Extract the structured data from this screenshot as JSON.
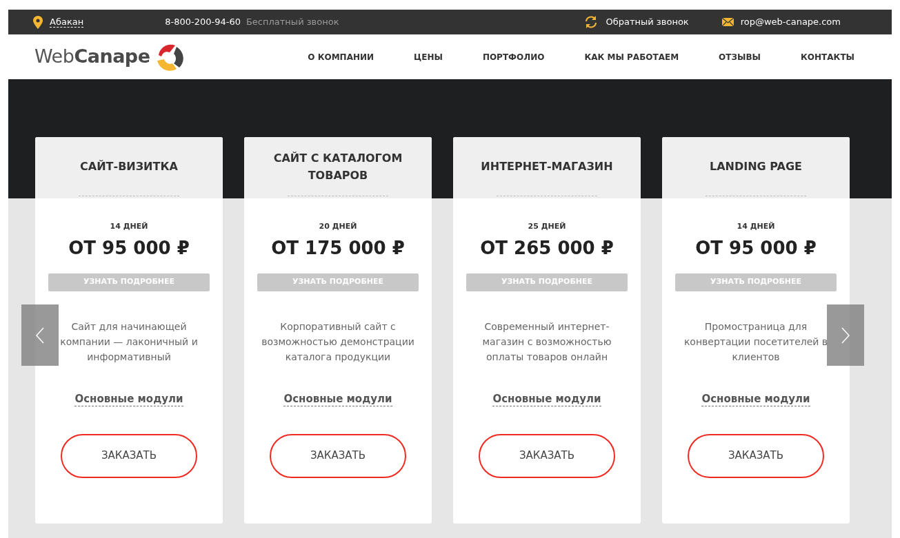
{
  "top_bar": {
    "city": "Абакан",
    "phone": "8-800-200-94-60",
    "phone_note": "Бесплатный звонок",
    "callback": "Обратный звонок",
    "email": "rop@web-canape.com"
  },
  "header": {
    "logo_light": "Web",
    "logo_bold": "Canape",
    "nav": [
      "О КОМПАНИИ",
      "ЦЕНЫ",
      "ПОРТФОЛИО",
      "КАК МЫ РАБОТАЕМ",
      "ОТЗЫВЫ",
      "КОНТАКТЫ"
    ]
  },
  "cards": [
    {
      "title": "САЙТ-ВИЗИТКА",
      "days": "14 ДНЕЙ",
      "price": "ОТ 95 000 ₽",
      "more": "УЗНАТЬ ПОДРОБНЕЕ",
      "description": "Сайт для начинающей компании — лаконичный и информативный",
      "modules": "Основные модули",
      "order": "ЗАКАЗАТЬ"
    },
    {
      "title": "САЙТ С КАТАЛОГОМ ТОВАРОВ",
      "days": "20 ДНЕЙ",
      "price": "ОТ 175 000 ₽",
      "more": "УЗНАТЬ ПОДРОБНЕЕ",
      "description": "Корпоративный сайт с возможностью демонстрации каталога продукции",
      "modules": "Основные модули",
      "order": "ЗАКАЗАТЬ"
    },
    {
      "title": "ИНТЕРНЕТ-МАГАЗИН",
      "days": "25 ДНЕЙ",
      "price": "ОТ 265 000 ₽",
      "more": "УЗНАТЬ ПОДРОБНЕЕ",
      "description": "Современный интернет-магазин с возможностью оплаты товаров онлайн",
      "modules": "Основные модули",
      "order": "ЗАКАЗАТЬ"
    },
    {
      "title": "LANDING PAGE",
      "days": "14 ДНЕЙ",
      "price": "ОТ 95 000 ₽",
      "more": "УЗНАТЬ ПОДРОБНЕЕ",
      "description": "Промостраница для конвертации посетителей в клиентов",
      "modules": "Основные модули",
      "order": "ЗАКАЗАТЬ"
    }
  ]
}
